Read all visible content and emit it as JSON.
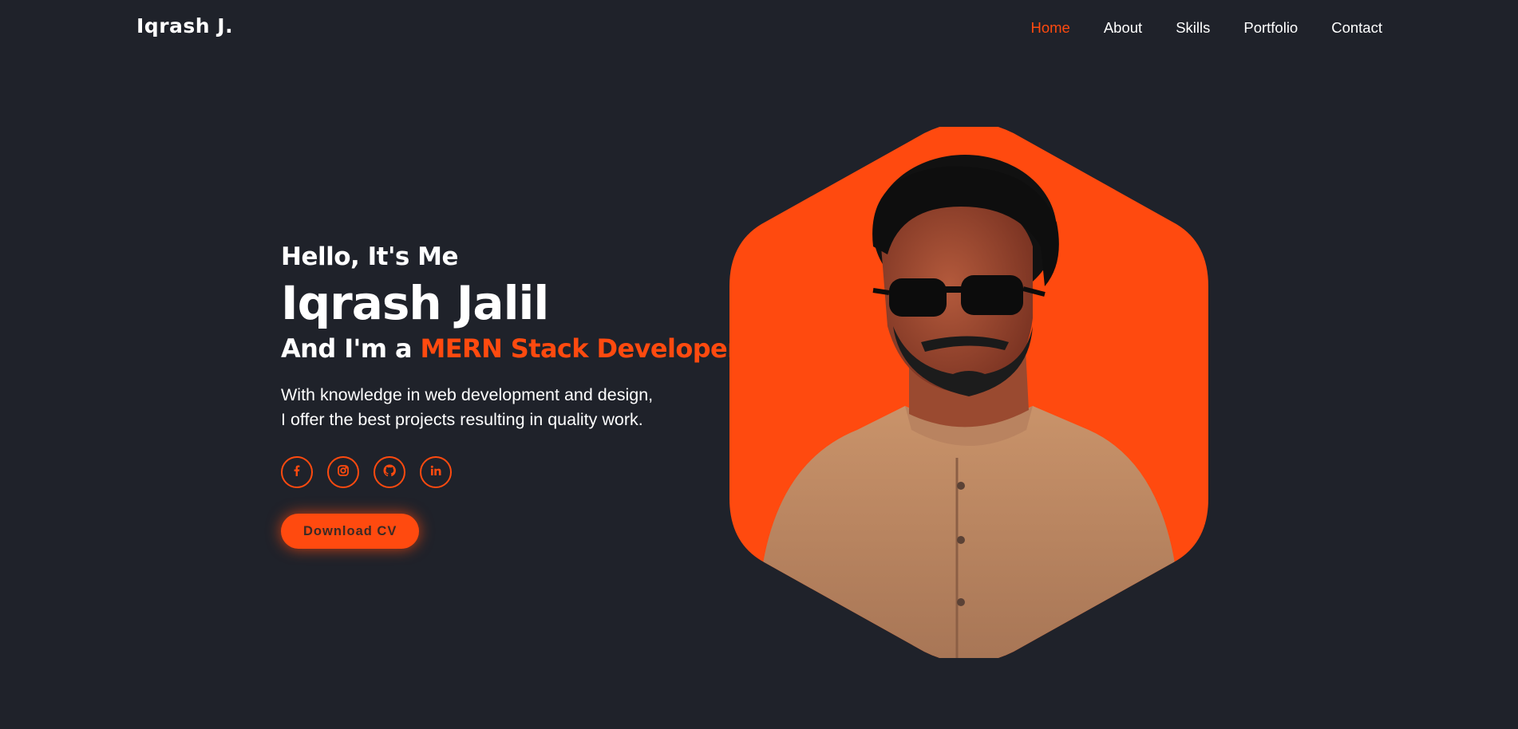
{
  "header": {
    "logo": "Iqrash J.",
    "nav": [
      "Home",
      "About",
      "Skills",
      "Portfolio",
      "Contact"
    ],
    "active_nav": "Home"
  },
  "hero": {
    "greeting": "Hello, It's Me",
    "name": "Iqrash Jalil",
    "role_prefix": "And I'm a ",
    "role": "MERN Stack Developer",
    "description_line1": "With knowledge in web development and design,",
    "description_line2": "I offer the best projects resulting in quality work.",
    "socials": [
      "facebook-icon",
      "instagram-icon",
      "github-icon",
      "linkedin-icon"
    ],
    "cta_label": "Download CV"
  },
  "colors": {
    "background": "#1f222a",
    "accent": "#ff4a0f",
    "text": "#ffffff"
  }
}
